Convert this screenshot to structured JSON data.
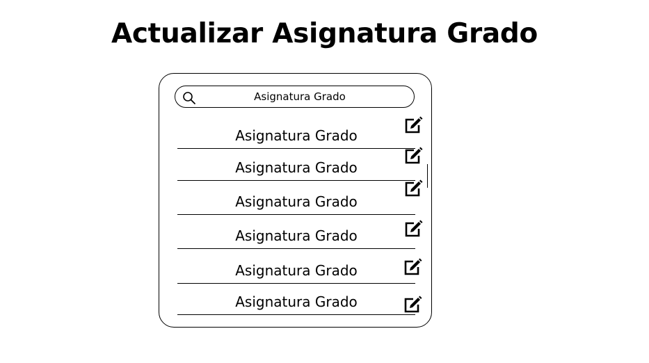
{
  "page": {
    "title": "Actualizar Asignatura Grado"
  },
  "search": {
    "value": "Asignatura Grado",
    "icon": "search-icon"
  },
  "list": {
    "items": [
      {
        "label": "Asignatura Grado",
        "action_icon": "edit-icon"
      },
      {
        "label": "Asignatura Grado",
        "action_icon": "edit-icon"
      },
      {
        "label": "Asignatura Grado",
        "action_icon": "edit-icon"
      },
      {
        "label": "Asignatura Grado",
        "action_icon": "edit-icon"
      },
      {
        "label": "Asignatura Grado",
        "action_icon": "edit-icon"
      },
      {
        "label": "Asignatura Grado",
        "action_icon": "edit-icon"
      }
    ]
  },
  "colors": {
    "background": "#ffffff",
    "foreground": "#000000"
  }
}
